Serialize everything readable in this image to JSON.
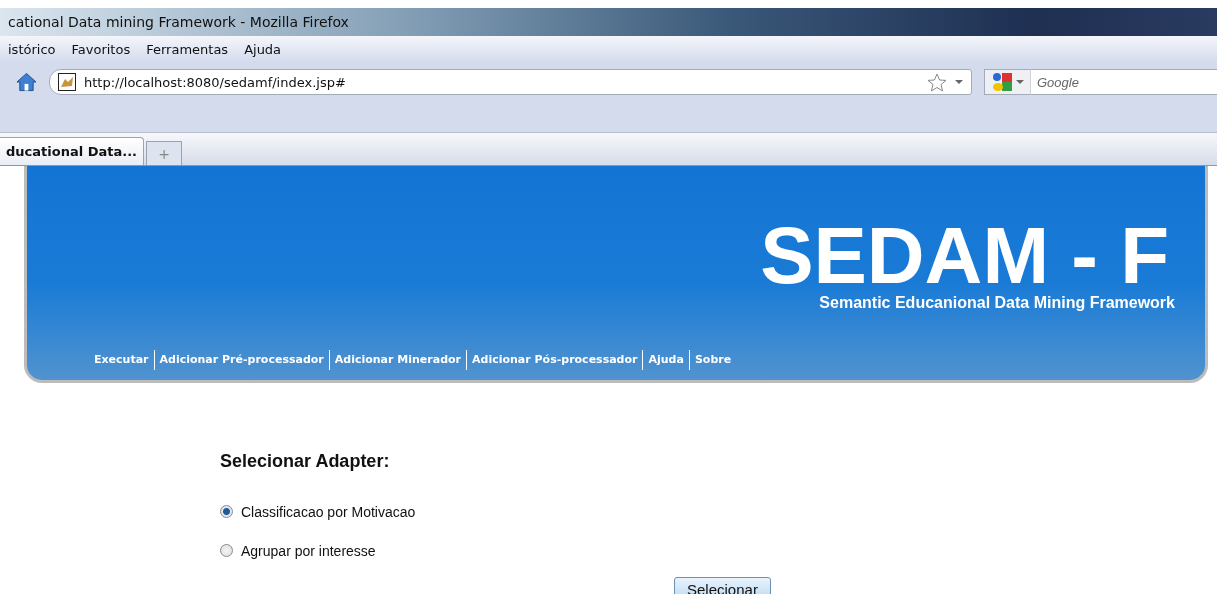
{
  "window": {
    "title": "cational Data mining Framework - Mozilla Firefox"
  },
  "menu": [
    "istórico",
    "Favoritos",
    "Ferramentas",
    "Ajuda"
  ],
  "address_bar": {
    "value": "http://localhost:8080/sedamf/index.jsp#"
  },
  "search": {
    "placeholder": "Google"
  },
  "tabs": [
    {
      "label": "ducational Data...",
      "selected": true
    }
  ],
  "new_tab": {
    "label": "+"
  },
  "header": {
    "title": "SEDAM - F",
    "subtitle": "Semantic Educanional Data Mining Framework",
    "nav": [
      "Executar",
      "Adicionar Pré-processador",
      "Adicionar Minerador",
      "Adicionar Pós-processador",
      "Ajuda",
      "Sobre"
    ]
  },
  "form": {
    "heading": "Selecionar Adapter:",
    "options": [
      {
        "label": "Classificacao por Motivacao",
        "selected": true
      },
      {
        "label": "Agrupar por interesse",
        "selected": false
      }
    ],
    "button": "Selecionar"
  }
}
